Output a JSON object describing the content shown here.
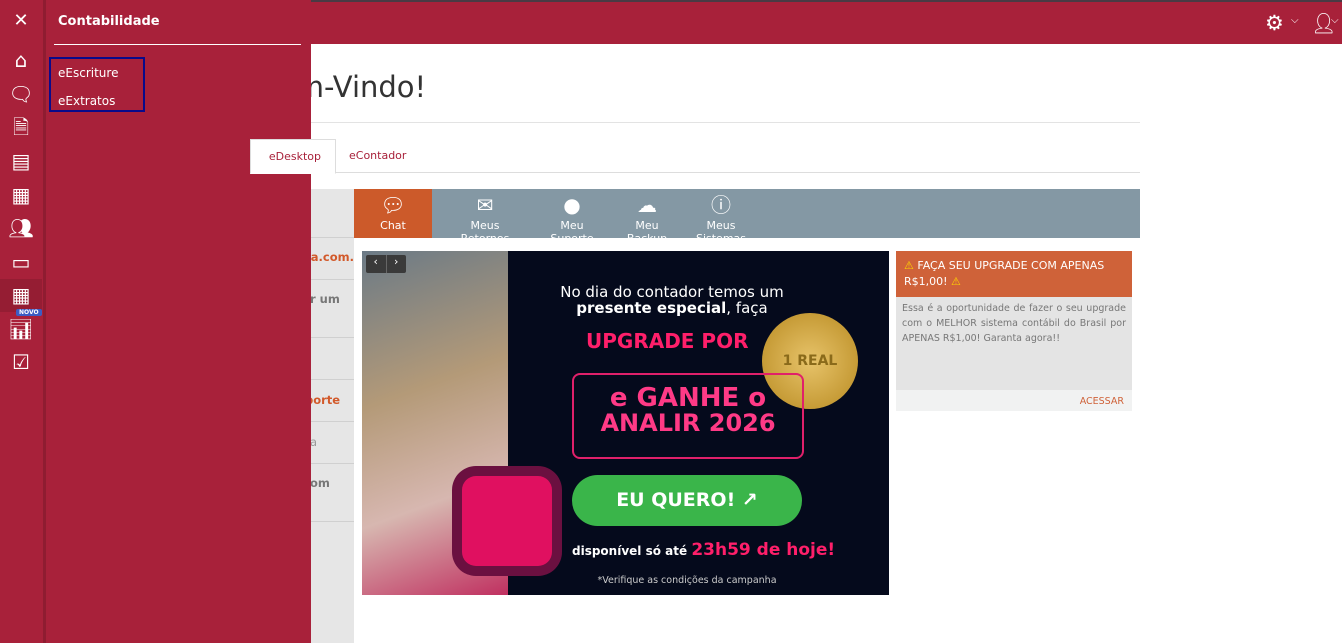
{
  "header": {
    "section_title": "Contabilidade",
    "close_icon": "close-icon",
    "settings_icon": "gear-icon",
    "user_icon": "user-icon"
  },
  "rail": {
    "icons": [
      "home-icon",
      "chat-bubbles-icon",
      "document-icon",
      "contact-card-icon",
      "building-icon",
      "users-icon",
      "credit-card-icon",
      "calculator-icon",
      "bar-chart-icon",
      "checkbox-icon"
    ],
    "new_badge": "NOVO"
  },
  "submenu": {
    "items": [
      "eEscriture",
      "eExtratos"
    ]
  },
  "main": {
    "title": "Bem-Vindo!",
    "tabs": [
      "eDesktop",
      "eContador"
    ],
    "left_links": [
      "data.com.",
      "r um",
      "porte",
      "a",
      "om"
    ],
    "toolbar": [
      "Chat",
      "Meus Retornos",
      "Meu Suporte",
      "Meu Backup",
      "Meus Sistemas"
    ]
  },
  "banner": {
    "line1": "No dia do contador temos um",
    "line2_bold": "presente especial",
    "line2_rest": ", faça",
    "upgrade": "UPGRADE POR",
    "ganhe": "e GANHE o",
    "analir": "ANALIR 2026",
    "cta": "EU QUERO!",
    "avail": "disponível só até",
    "deadline": "23h59 de hoje!",
    "note": "*Verifique as condições da campanha",
    "coin": "1 REAL"
  },
  "promo": {
    "title": "FAÇA SEU UPGRADE COM APENAS R$1,00!",
    "body": "Essa é a oportunidade de fazer o seu upgrade com o MELHOR sistema contábil do Brasil por APENAS R$1,00! Garanta agora!!",
    "action": "ACESSAR"
  },
  "colors": {
    "brand": "#a8213a",
    "accent": "#cc5a2a",
    "toolbar": "#8498a4",
    "cta": "#3ab54a",
    "pink": "#ff1f6a"
  }
}
